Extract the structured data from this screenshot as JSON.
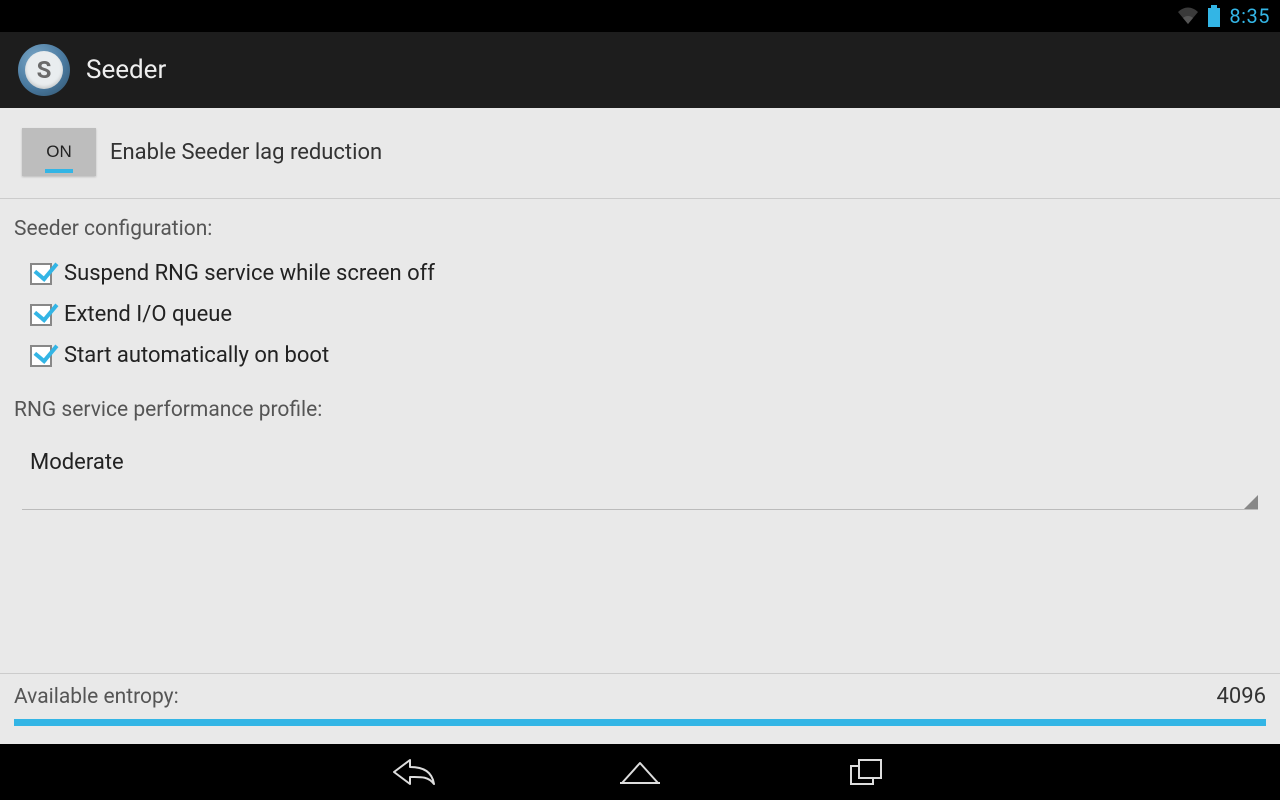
{
  "status": {
    "time": "8:35"
  },
  "header": {
    "title": "Seeder"
  },
  "toggle": {
    "state": "ON",
    "label": "Enable Seeder lag reduction"
  },
  "config": {
    "title": "Seeder configuration:",
    "items": [
      {
        "label": "Suspend RNG service while screen off",
        "checked": true
      },
      {
        "label": "Extend I/O queue",
        "checked": true
      },
      {
        "label": "Start automatically on boot",
        "checked": true
      }
    ]
  },
  "profile": {
    "title": "RNG service performance profile:",
    "value": "Moderate"
  },
  "entropy": {
    "label": "Available entropy:",
    "value": "4096"
  }
}
